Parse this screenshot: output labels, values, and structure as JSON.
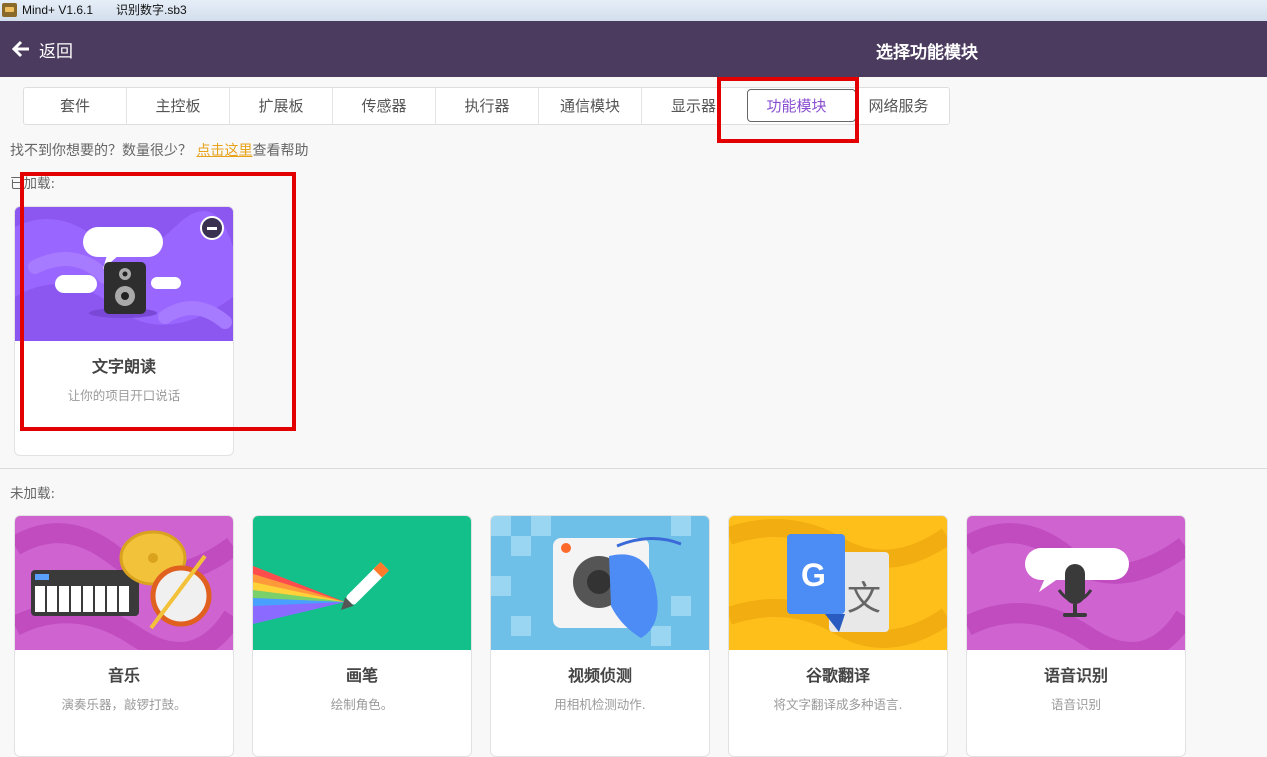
{
  "window": {
    "app_title": "Mind+ V1.6.1",
    "file_name": "识别数字.sb3"
  },
  "header": {
    "back_label": "返回",
    "title": "选择功能模块"
  },
  "tabs": [
    {
      "label": "套件"
    },
    {
      "label": "主控板"
    },
    {
      "label": "扩展板"
    },
    {
      "label": "传感器"
    },
    {
      "label": "执行器"
    },
    {
      "label": "通信模块"
    },
    {
      "label": "显示器"
    },
    {
      "label": "功能模块",
      "active": true
    },
    {
      "label": "网络服务"
    }
  ],
  "help": {
    "prefix": "找不到你想要的？数量很少？",
    "link": "点击这里",
    "suffix": "查看帮助"
  },
  "loaded": {
    "label": "已加载:",
    "items": [
      {
        "name": "文字朗读",
        "desc": "让你的项目开口说话"
      }
    ]
  },
  "unloaded": {
    "label": "未加载:",
    "items": [
      {
        "name": "音乐",
        "desc": "演奏乐器，敲锣打鼓。"
      },
      {
        "name": "画笔",
        "desc": "绘制角色。"
      },
      {
        "name": "视频侦测",
        "desc": "用相机检测动作."
      },
      {
        "name": "谷歌翻译",
        "desc": "将文字翻译成多种语言."
      },
      {
        "name": "语音识别",
        "desc": "语音识别"
      }
    ]
  },
  "colors": {
    "header_bg": "#4b3b5e",
    "active_tab": "#8a4fd0",
    "link": "#e7a21a",
    "highlight": "#e30000"
  }
}
